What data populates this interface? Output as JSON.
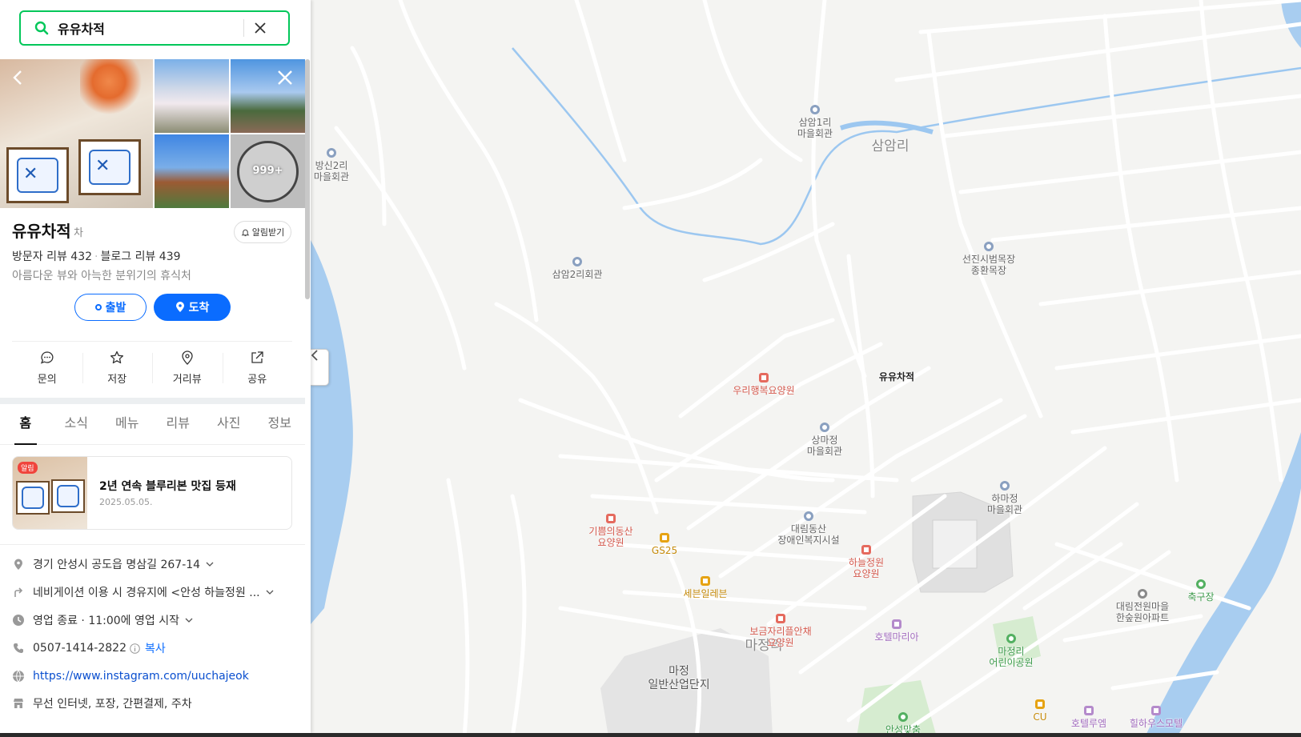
{
  "search": {
    "query": "유유차적",
    "placeholder": ""
  },
  "photos": {
    "more_count": "999+"
  },
  "place": {
    "name": "유유차적",
    "category": "차",
    "alarm_label": "알림받기",
    "visitor_reviews": "방문자 리뷰 432",
    "blog_reviews": "블로그 리뷰 439",
    "tagline": "아름다운 뷰와 아늑한 분위기의 휴식처"
  },
  "buttons": {
    "start": "출발",
    "arrive": "도착"
  },
  "actions": [
    {
      "label": "문의",
      "icon": "chat-bubble-icon"
    },
    {
      "label": "저장",
      "icon": "star-icon"
    },
    {
      "label": "거리뷰",
      "icon": "map-pin-icon"
    },
    {
      "label": "공유",
      "icon": "share-icon"
    }
  ],
  "tabs": [
    "홈",
    "소식",
    "메뉴",
    "리뷰",
    "사진",
    "정보"
  ],
  "notice": {
    "badge": "알림",
    "title": "2년 연속 블루리본 맛집 등재",
    "date": "2025.05.05."
  },
  "info": {
    "address": "경기 안성시 공도읍 명삼길 267-14",
    "navigation": "네비게이션 이용 시 경유지에 <안성 하늘정원 ...",
    "hours": "영업 종료 · 11:00에 영업 시작",
    "phone": "0507-1414-2822",
    "copy_label": "복사",
    "website": "https://www.instagram.com/uuchajeok",
    "facilities": "무선 인터넷, 포장, 간편결제, 주차"
  },
  "map": {
    "pin_label": "유유차적",
    "areas": [
      {
        "text": "삼암리"
      },
      {
        "text": "마정리"
      },
      {
        "text": "마정\n일반산업단지"
      }
    ],
    "pois": [
      {
        "text": "삼암1리\n마을회관",
        "kind": "blue"
      },
      {
        "text": "방신2리\n마을회관",
        "kind": "blue"
      },
      {
        "text": "삼암2리회관",
        "kind": "blue"
      },
      {
        "text": "선진시범목장\n종환목장",
        "kind": "blue"
      },
      {
        "text": "우리행복요양원",
        "kind": "red"
      },
      {
        "text": "상마정\n마을회관",
        "kind": "blue"
      },
      {
        "text": "하마정\n마을회관",
        "kind": "blue"
      },
      {
        "text": "대림동산\n장애인복지시설",
        "kind": "blue"
      },
      {
        "text": "기쁨의동산\n요양원",
        "kind": "red"
      },
      {
        "text": "GS25",
        "kind": "orange"
      },
      {
        "text": "하늘정원\n요양원",
        "kind": "red"
      },
      {
        "text": "세븐일레븐",
        "kind": "orange"
      },
      {
        "text": "보금자리플안채\n요양원",
        "kind": "red"
      },
      {
        "text": "호텔마리아",
        "kind": "purple"
      },
      {
        "text": "마정리\n어린이공원",
        "kind": "green"
      },
      {
        "text": "대림전원마을\n한숲원아파트",
        "kind": "gray"
      },
      {
        "text": "축구장",
        "kind": "green"
      },
      {
        "text": "CU",
        "kind": "orange"
      },
      {
        "text": "호텔루엠",
        "kind": "purple"
      },
      {
        "text": "힐하우스모텔",
        "kind": "purple"
      },
      {
        "text": "안성맞춤",
        "kind": "green"
      }
    ]
  },
  "colors": {
    "accent": "#03c75a",
    "primary": "#0a6cff",
    "pin": "#f0564a"
  }
}
